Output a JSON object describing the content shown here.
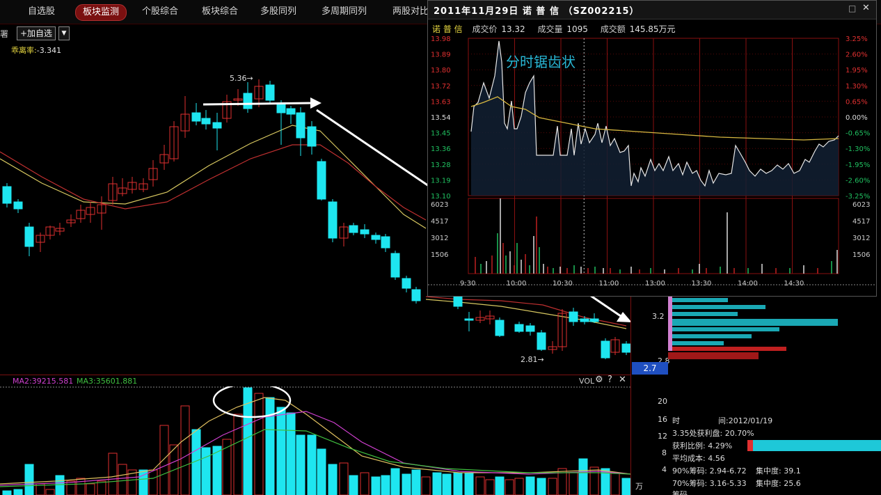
{
  "tabs": [
    {
      "label": "自选股",
      "active": false
    },
    {
      "label": "板块监测",
      "active": true
    },
    {
      "label": "个股综合",
      "active": false
    },
    {
      "label": "板块综合",
      "active": false
    },
    {
      "label": "多股同列",
      "active": false
    },
    {
      "label": "多周期同列",
      "active": false
    },
    {
      "label": "两股对比",
      "active": false
    }
  ],
  "toolbar": {
    "left_text": "署",
    "add_favorite": "+加自选",
    "dropdown_icon": "chevron-down-icon"
  },
  "indicator": {
    "name": "乖离率",
    "value": "-3.341"
  },
  "main_chart": {
    "high_label": "5.36",
    "low_label": "2.81",
    "price_axis": [
      "3.2",
      "2.8"
    ],
    "current_price": "2.7"
  },
  "volume_panel": {
    "ma2": "MA2:39215.581",
    "ma3": "MA3:35601.881",
    "label": "VOL",
    "axis": [
      "20",
      "16",
      "12",
      "8",
      "4",
      "万"
    ]
  },
  "inset": {
    "title": "2011年11月29日 诺 普 信 （SZ002215）",
    "stock_name": "诺 普 信",
    "price_label": "成交价",
    "price_value": "13.32",
    "volume_label": "成交量",
    "volume_value": "1095",
    "amount_label": "成交额",
    "amount_value": "145.85万元",
    "annotation": "分时锯齿状",
    "left_axis": [
      "13.98",
      "13.89",
      "13.80",
      "13.72",
      "13.63",
      "13.54",
      "13.45",
      "13.36",
      "13.28",
      "13.19",
      "13.10"
    ],
    "right_axis": [
      "3.25%",
      "2.60%",
      "1.95%",
      "1.30%",
      "0.65%",
      "0.00%",
      "-0.65%",
      "-1.30%",
      "-1.95%",
      "-2.60%",
      "-3.25%"
    ],
    "vol_axis": [
      "6023",
      "4517",
      "3012",
      "1506"
    ],
    "time_axis": [
      "9:30",
      "10:00",
      "10:30",
      "11:00",
      "13:00",
      "13:30",
      "14:00",
      "14:30"
    ]
  },
  "right_panel": {
    "time_label": "时",
    "date_label": "间:2012/01/19",
    "profit_line": "3.35处获利盘: 20.70%",
    "profit_ratio": "获利比例: 4.29%",
    "avg_cost": "平均成本: 4.56",
    "chip90": "90%筹码: 2.94-6.72",
    "conc90": "集中度: 39.1",
    "chip70": "70%筹码: 3.16-5.33",
    "conc70": "集中度: 25.6",
    "last_line": "筹码..."
  },
  "colors": {
    "up": "#e03030",
    "down": "#1ee6f0",
    "ma_yellow": "#d8c860",
    "ma_red": "#c03030",
    "annotation": "#29b6d4"
  }
}
